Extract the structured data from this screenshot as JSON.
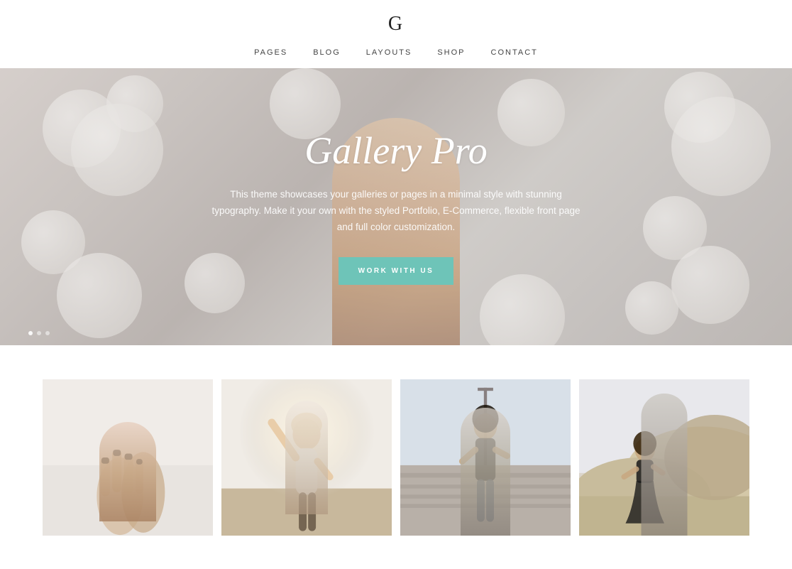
{
  "header": {
    "logo": "G",
    "nav": {
      "items": [
        {
          "label": "PAGES",
          "id": "pages"
        },
        {
          "label": "BLOG",
          "id": "blog"
        },
        {
          "label": "LAYOUTS",
          "id": "layouts"
        },
        {
          "label": "SHOP",
          "id": "shop"
        },
        {
          "label": "CONTACT",
          "id": "contact"
        }
      ]
    }
  },
  "hero": {
    "title": "Gallery Pro",
    "subtitle": "This theme showcases your galleries or pages in a minimal style with stunning typography. Make it your own with the styled Portfolio, E-Commerce, flexible front page and full color customization.",
    "cta_label": "WORK WITH US",
    "dots": [
      {
        "active": true
      },
      {
        "active": false
      },
      {
        "active": false
      }
    ]
  },
  "gallery": {
    "items": [
      {
        "id": "img-1",
        "alt": "Hands photo"
      },
      {
        "id": "img-2",
        "alt": "Woman with arms raised"
      },
      {
        "id": "img-3",
        "alt": "Woman in black dress on dock"
      },
      {
        "id": "img-4",
        "alt": "Woman in black skirt near dunes"
      }
    ]
  }
}
